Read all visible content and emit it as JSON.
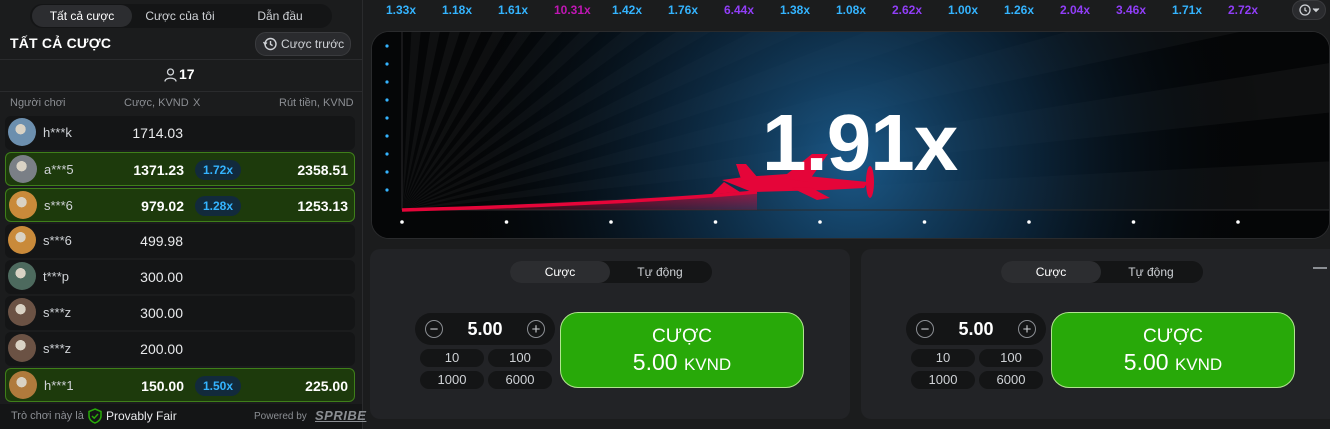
{
  "left_panel": {
    "tabs": [
      "Tất cả cược",
      "Cược của tôi",
      "Dẫn đầu"
    ],
    "title": "TẤT CẢ CƯỢC",
    "prev_button": "Cược trước",
    "player_count": "17",
    "columns": {
      "player": "Người chơi",
      "bet": "Cược, KVND",
      "x": "X",
      "cashout": "Rút tiền, KVND"
    },
    "rows": [
      {
        "user": "h***k",
        "bet": "1714.03",
        "mult": "",
        "win": "",
        "won": false,
        "avatar_color": "#6c8fae"
      },
      {
        "user": "a***5",
        "bet": "1371.23",
        "mult": "1.72x",
        "win": "2358.51",
        "won": true,
        "avatar_color": "#7a7f86"
      },
      {
        "user": "s***6",
        "bet": "979.02",
        "mult": "1.28x",
        "win": "1253.13",
        "won": true,
        "avatar_color": "#c98a3a"
      },
      {
        "user": "s***6",
        "bet": "499.98",
        "mult": "",
        "win": "",
        "won": false,
        "avatar_color": "#c98a3a"
      },
      {
        "user": "t***p",
        "bet": "300.00",
        "mult": "",
        "win": "",
        "won": false,
        "avatar_color": "#4d6a5e"
      },
      {
        "user": "s***z",
        "bet": "300.00",
        "mult": "",
        "win": "",
        "won": false,
        "avatar_color": "#6b5244"
      },
      {
        "user": "s***z",
        "bet": "200.00",
        "mult": "",
        "win": "",
        "won": false,
        "avatar_color": "#6b5244"
      },
      {
        "user": "h***1",
        "bet": "150.00",
        "mult": "1.50x",
        "win": "225.00",
        "won": true,
        "avatar_color": "#b07a3c"
      }
    ],
    "footer": {
      "fair_text": "Trò chơi này là",
      "fair_label": "Provably Fair",
      "powered": "Powered by",
      "brand": "SPRIBE"
    }
  },
  "history": [
    {
      "v": "1.33x",
      "color": "#34b4ff"
    },
    {
      "v": "1.18x",
      "color": "#34b4ff"
    },
    {
      "v": "1.61x",
      "color": "#34b4ff"
    },
    {
      "v": "10.31x",
      "color": "#c017b4"
    },
    {
      "v": "1.42x",
      "color": "#34b4ff"
    },
    {
      "v": "1.76x",
      "color": "#34b4ff"
    },
    {
      "v": "6.44x",
      "color": "#913ef8"
    },
    {
      "v": "1.38x",
      "color": "#34b4ff"
    },
    {
      "v": "1.08x",
      "color": "#34b4ff"
    },
    {
      "v": "2.62x",
      "color": "#913ef8"
    },
    {
      "v": "1.00x",
      "color": "#34b4ff"
    },
    {
      "v": "1.26x",
      "color": "#34b4ff"
    },
    {
      "v": "2.04x",
      "color": "#913ef8"
    },
    {
      "v": "3.46x",
      "color": "#913ef8"
    },
    {
      "v": "1.71x",
      "color": "#34b4ff"
    },
    {
      "v": "2.72x",
      "color": "#913ef8"
    }
  ],
  "game": {
    "multiplier": "1.91x",
    "accent": "#e50539"
  },
  "panels": [
    {
      "tabs": [
        "Cược",
        "Tự động"
      ],
      "amount": "5.00",
      "quick": [
        "10",
        "100",
        "1000",
        "6000"
      ],
      "btn_line1": "CƯỢC",
      "btn_amount": "5.00",
      "btn_currency": "KVND"
    },
    {
      "tabs": [
        "Cược",
        "Tự động"
      ],
      "amount": "5.00",
      "quick": [
        "10",
        "100",
        "1000",
        "6000"
      ],
      "btn_line1": "CƯỢC",
      "btn_amount": "5.00",
      "btn_currency": "KVND"
    }
  ]
}
